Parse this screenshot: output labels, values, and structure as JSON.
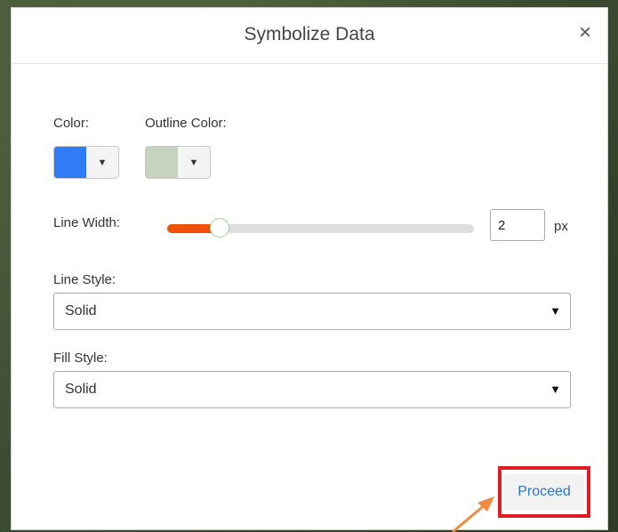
{
  "dialog": {
    "title": "Symbolize Data",
    "close_glyph": "×"
  },
  "color": {
    "label": "Color:",
    "value": "#2f7cf6",
    "arrow": "▼"
  },
  "outline_color": {
    "label": "Outline Color:",
    "value": "#c5d3bf",
    "arrow": "▼"
  },
  "line_width": {
    "label": "Line Width:",
    "value": "2",
    "unit": "px",
    "slider_fraction": 0.17,
    "fill_color": "#f0500a"
  },
  "line_style": {
    "label": "Line Style:",
    "selected": "Solid",
    "arrow": "▼"
  },
  "fill_style": {
    "label": "Fill Style:",
    "selected": "Solid",
    "arrow": "▼"
  },
  "proceed": {
    "label": "Proceed",
    "highlight_color": "#e31b23"
  },
  "annotation": {
    "arrow_color": "#f08a3c"
  }
}
